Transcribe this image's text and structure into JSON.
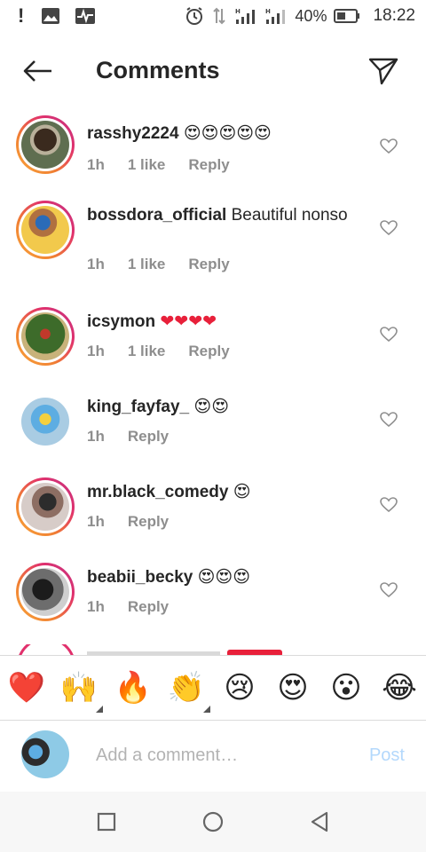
{
  "status_bar": {
    "battery": "40%",
    "time": "18:22",
    "icons": [
      "alert-icon",
      "image-icon",
      "activity-icon",
      "alarm-icon",
      "data-icon",
      "signal-icon",
      "signal-icon",
      "battery-icon"
    ]
  },
  "header": {
    "title": "Comments",
    "back_icon": "arrow-left-icon",
    "send_icon": "direct-send-icon"
  },
  "comments": [
    {
      "username": "rasshy2224",
      "text": "",
      "emoji": "😍😍😍😍😍",
      "time": "1h",
      "likes": "1 like",
      "reply": "Reply"
    },
    {
      "username": "bossdora_official",
      "text": " Beautiful nonso",
      "emoji": "",
      "time": "1h",
      "likes": "1 like",
      "reply": "Reply"
    },
    {
      "username": "icsymon",
      "text": "",
      "emoji": "❤❤❤❤",
      "time": "1h",
      "likes": "1 like",
      "reply": "Reply"
    },
    {
      "username": "king_fayfay_",
      "text": "",
      "emoji": "😍😍",
      "time": "1h",
      "likes": "",
      "reply": "Reply"
    },
    {
      "username": "mr.black_comedy",
      "text": "",
      "emoji": "😍",
      "time": "1h",
      "likes": "",
      "reply": "Reply"
    },
    {
      "username": "beabii_becky",
      "text": "",
      "emoji": "😍😍😍",
      "time": "1h",
      "likes": "",
      "reply": "Reply"
    }
  ],
  "emoji_bar": [
    "❤️",
    "🙌",
    "🔥",
    "👏",
    "😢",
    "😍",
    "😮",
    "😂"
  ],
  "comment_box": {
    "placeholder": "Add a comment…",
    "value": "",
    "post_label": "Post"
  },
  "colors": {
    "story_ring_start": "#f9a63a",
    "story_ring_end": "#c13584",
    "muted_text": "#8e8e8e",
    "post_disabled": "#b3d8fc",
    "heart_red": "#e8203a"
  }
}
